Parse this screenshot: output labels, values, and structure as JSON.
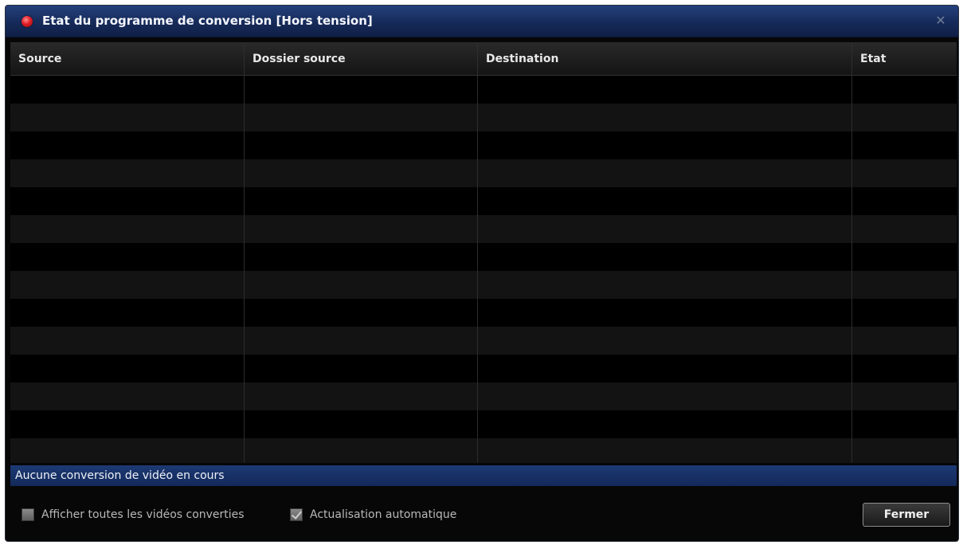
{
  "window": {
    "title": "Etat du programme de conversion [Hors tension]",
    "close_glyph": "✕",
    "status_icon": "red-status-dot",
    "accent_color": "#1a3468"
  },
  "table": {
    "columns": [
      "Source",
      "Dossier source",
      "Destination",
      "Etat"
    ],
    "rows": []
  },
  "status": {
    "text": "Aucune conversion de vidéo en cours"
  },
  "footer": {
    "show_all_label": "Afficher toutes les vidéos converties",
    "show_all_checked": false,
    "auto_refresh_label": "Actualisation automatique",
    "auto_refresh_checked": true,
    "close_button_label": "Fermer"
  }
}
